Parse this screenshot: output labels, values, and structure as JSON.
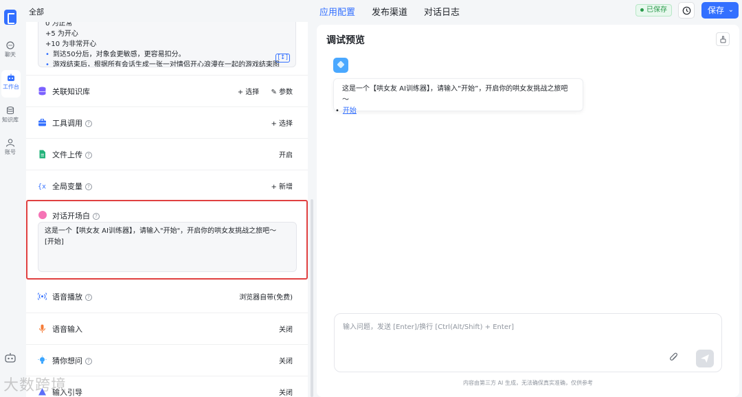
{
  "rail": {
    "items": [
      {
        "label": "聊天",
        "icon": "chat-icon"
      },
      {
        "label": "工作台",
        "icon": "robot-icon",
        "active": true
      },
      {
        "label": "知识库",
        "icon": "database-icon"
      },
      {
        "label": "账号",
        "icon": "user-icon"
      }
    ]
  },
  "header": {
    "breadcrumb": "全部",
    "tabs": [
      {
        "label": "应用配置",
        "active": true
      },
      {
        "label": "发布渠道"
      },
      {
        "label": "对话日志"
      }
    ],
    "saved_badge": "已保存",
    "save_label": "保存"
  },
  "prompt_preview": {
    "lines": [
      "0 为正常",
      "+5 为开心",
      "+10 为非常开心"
    ],
    "bullets": [
      "到达50分后，对象会更敏感，更容易扣分。",
      "游戏结束后，根据所有会话生成一张一对情侣开心浪漫在一起的游戏结束图"
    ]
  },
  "config_rows": [
    {
      "label": "关联知识库",
      "actions": [
        "+ 选择",
        "参数"
      ],
      "help": false
    },
    {
      "label": "工具调用",
      "actions": [
        "+ 选择"
      ],
      "help": true
    },
    {
      "label": "文件上传",
      "actions": [
        "开启"
      ],
      "help": true
    },
    {
      "label": "全局变量",
      "actions": [
        "+ 新增"
      ],
      "help": true
    }
  ],
  "opener": {
    "label": "对话开场白",
    "value": "这是一个【哄女友 AI训练器】，请输入\"开始\"，开启你的哄女友挑战之旅吧～\n[开始]"
  },
  "config_rows_bottom": [
    {
      "label": "语音播放",
      "actions": [
        "浏览器自带(免费)"
      ],
      "help": true
    },
    {
      "label": "语音输入",
      "actions": [
        "关闭"
      ],
      "help": false
    },
    {
      "label": "猜你想问",
      "actions": [
        "关闭"
      ],
      "help": true
    },
    {
      "label": "输入引导",
      "actions": [
        "关闭"
      ],
      "help": false
    }
  ],
  "preview": {
    "title": "调试预览",
    "message": "这是一个【哄女友 AI训练器】，请输入“开始”，开启你的哄女友挑战之旅吧～",
    "start_link": "开始",
    "input_placeholder": "输入问题，发送 [Enter]/换行 [Ctrl(Alt/Shift) + Enter]",
    "disclaimer": "内容由第三方 AI 生成，无法确保真实准确，仅供参考"
  },
  "watermark": "大数跨境",
  "colors": {
    "accent": "#3370ff",
    "highlight_border": "#e03f3f",
    "saved_green": "#2a9a4b"
  }
}
